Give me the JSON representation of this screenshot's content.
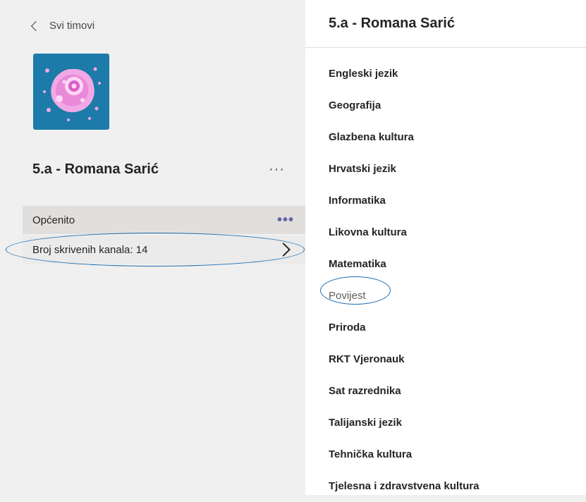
{
  "nav": {
    "back_label": "Svi timovi"
  },
  "team": {
    "name": "5.a - Romana Sarić",
    "more_label": "···",
    "avatar_color": "#1c7ba8"
  },
  "channels": {
    "general": {
      "label": "Općenito",
      "more_label": "•••"
    },
    "hidden": {
      "label": "Broj skrivenih kanala: 14"
    }
  },
  "hidden_panel": {
    "title": "5.a - Romana Sarić",
    "items": [
      {
        "label": "Engleski jezik"
      },
      {
        "label": "Geografija"
      },
      {
        "label": "Glazbena kultura"
      },
      {
        "label": "Hrvatski jezik"
      },
      {
        "label": "Informatika"
      },
      {
        "label": "Likovna kultura"
      },
      {
        "label": "Matematika"
      },
      {
        "label": "Povijest"
      },
      {
        "label": "Priroda"
      },
      {
        "label": "RKT Vjeronauk"
      },
      {
        "label": "Sat razrednika"
      },
      {
        "label": "Talijanski jezik"
      },
      {
        "label": "Tehnička kultura"
      },
      {
        "label": "Tjelesna i zdravstvena kultura"
      }
    ]
  },
  "colors": {
    "accent_purple": "#6264a7",
    "highlight_blue": "#1f6fb0"
  }
}
